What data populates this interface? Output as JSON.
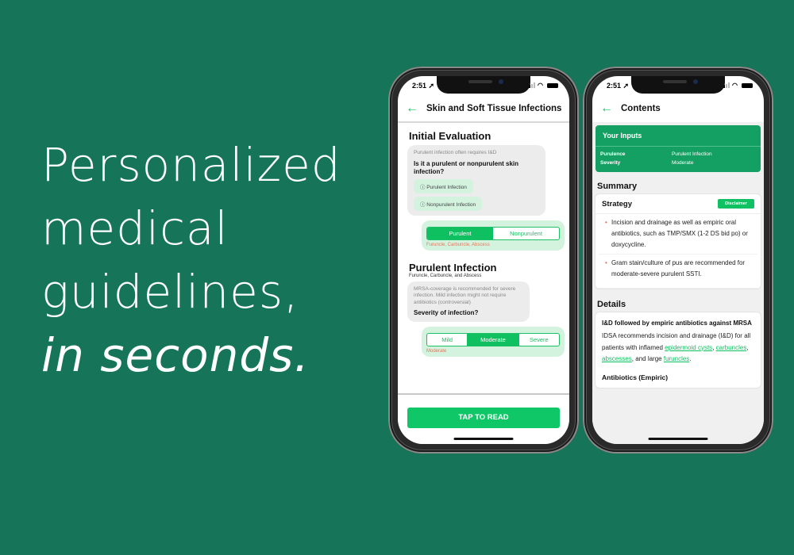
{
  "headline": {
    "line1": "Personalized",
    "line2": "medical",
    "line3": "guidelines,",
    "line4": "in seconds."
  },
  "colors": {
    "background": "#167558",
    "accent": "#0fc766",
    "inputs_card": "#14a062",
    "note": "#e3785a"
  },
  "phone1": {
    "status": {
      "time": "2:51",
      "location_icon": "location-arrow-icon"
    },
    "nav": {
      "back_icon": "arrow-left-icon",
      "title": "Skin and Soft Tissue Infections"
    },
    "sections": [
      {
        "title": "Initial Evaluation",
        "hint": "Purulent infection often requires I&D",
        "question": "Is it a purulent or nonpurulent skin infection?",
        "chips": [
          "ⓘ Purulent Infection",
          "ⓘ Nonpurulent Infection"
        ],
        "options": [
          "Purulent",
          "Nonpurulent"
        ],
        "selected": "Purulent",
        "note": "Furuncle, Carbuncle, Abscess"
      },
      {
        "title": "Purulent Infection",
        "subtitle": "Furuncle, Carbuncle, and Abscess",
        "hint": "MRSA-coverage is recommended for severe infection. Mild infection might not require antibiotics (controversial)",
        "question": "Severity of infection?",
        "options": [
          "Mild",
          "Moderate",
          "Severe"
        ],
        "selected": "Moderate",
        "note": "Moderate"
      }
    ],
    "tap_button": "TAP TO READ"
  },
  "phone2": {
    "status": {
      "time": "2:51"
    },
    "nav": {
      "back_icon": "arrow-left-icon",
      "title": "Contents"
    },
    "inputs": {
      "title": "Your Inputs",
      "rows": [
        {
          "key": "Purulence",
          "value": "Purulent Infection"
        },
        {
          "key": "Severity",
          "value": "Moderate"
        }
      ]
    },
    "summary": {
      "heading": "Summary",
      "card_title": "Strategy",
      "disclaimer": "Disclaimer",
      "bullets": [
        "Incision and drainage as well as empiric oral antibiotics, such as TMP/SMX (1-2 DS bid po) or doxycycline.",
        "Gram stain/culture of pus are recommended for moderate-severe purulent SSTI."
      ]
    },
    "details": {
      "heading": "Details",
      "title": "I&D followed by empiric antibiotics against MRSA",
      "text_before": "IDSA recommends incision and drainage (I&D) for all patients with inflamed ",
      "links": [
        "epidermoid cysts",
        "carbuncles",
        "abscesses",
        "furuncles"
      ],
      "sep1": ", ",
      "sep2": ", ",
      "sep3": ", and large ",
      "text_after": ".",
      "subheading": "Antibiotics (Empiric)"
    }
  }
}
